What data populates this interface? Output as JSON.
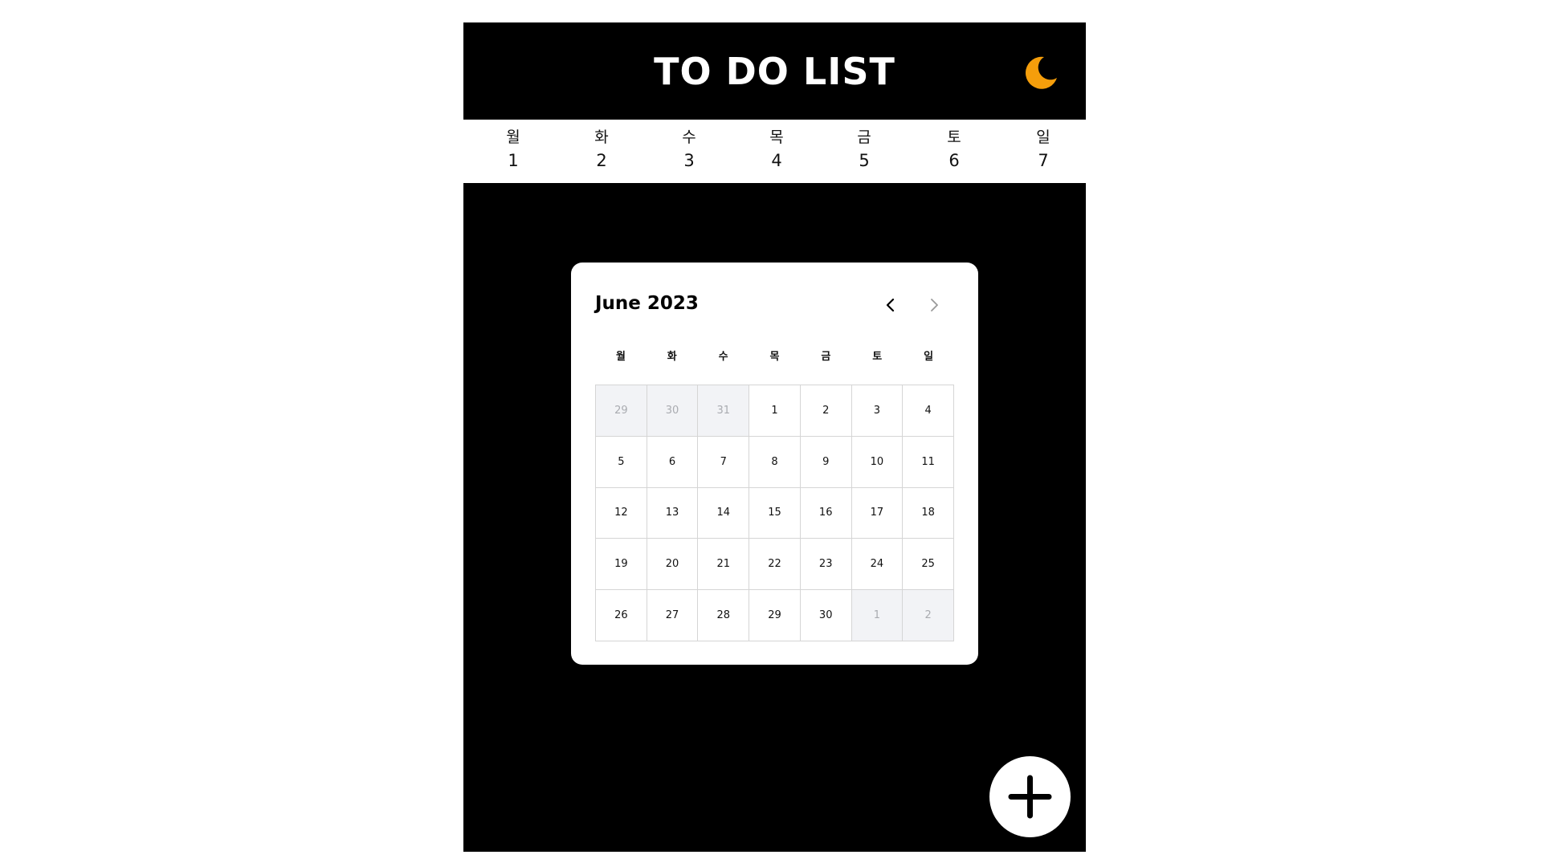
{
  "header": {
    "title": "TO DO LIST",
    "theme_icon": "moon-icon",
    "theme_icon_color": "#F59E0B"
  },
  "week": [
    {
      "name": "월",
      "num": "1"
    },
    {
      "name": "화",
      "num": "2"
    },
    {
      "name": "수",
      "num": "3"
    },
    {
      "name": "목",
      "num": "4"
    },
    {
      "name": "금",
      "num": "5"
    },
    {
      "name": "토",
      "num": "6"
    },
    {
      "name": "일",
      "num": "7"
    }
  ],
  "calendar": {
    "month_label": "June 2023",
    "prev_icon": "chevron-left-icon",
    "next_icon": "chevron-right-icon",
    "weekdays": [
      "월",
      "화",
      "수",
      "목",
      "금",
      "토",
      "일"
    ],
    "days": [
      {
        "label": "29",
        "other": true
      },
      {
        "label": "30",
        "other": true
      },
      {
        "label": "31",
        "other": true
      },
      {
        "label": "1",
        "other": false
      },
      {
        "label": "2",
        "other": false
      },
      {
        "label": "3",
        "other": false
      },
      {
        "label": "4",
        "other": false
      },
      {
        "label": "5",
        "other": false
      },
      {
        "label": "6",
        "other": false
      },
      {
        "label": "7",
        "other": false
      },
      {
        "label": "8",
        "other": false
      },
      {
        "label": "9",
        "other": false
      },
      {
        "label": "10",
        "other": false
      },
      {
        "label": "11",
        "other": false
      },
      {
        "label": "12",
        "other": false
      },
      {
        "label": "13",
        "other": false
      },
      {
        "label": "14",
        "other": false
      },
      {
        "label": "15",
        "other": false
      },
      {
        "label": "16",
        "other": false
      },
      {
        "label": "17",
        "other": false
      },
      {
        "label": "18",
        "other": false
      },
      {
        "label": "19",
        "other": false
      },
      {
        "label": "20",
        "other": false
      },
      {
        "label": "21",
        "other": false
      },
      {
        "label": "22",
        "other": false
      },
      {
        "label": "23",
        "other": false
      },
      {
        "label": "24",
        "other": false
      },
      {
        "label": "25",
        "other": false
      },
      {
        "label": "26",
        "other": false
      },
      {
        "label": "27",
        "other": false
      },
      {
        "label": "28",
        "other": false
      },
      {
        "label": "29",
        "other": false
      },
      {
        "label": "30",
        "other": false
      },
      {
        "label": "1",
        "other": true
      },
      {
        "label": "2",
        "other": true
      }
    ]
  },
  "fab": {
    "icon": "plus-icon"
  }
}
